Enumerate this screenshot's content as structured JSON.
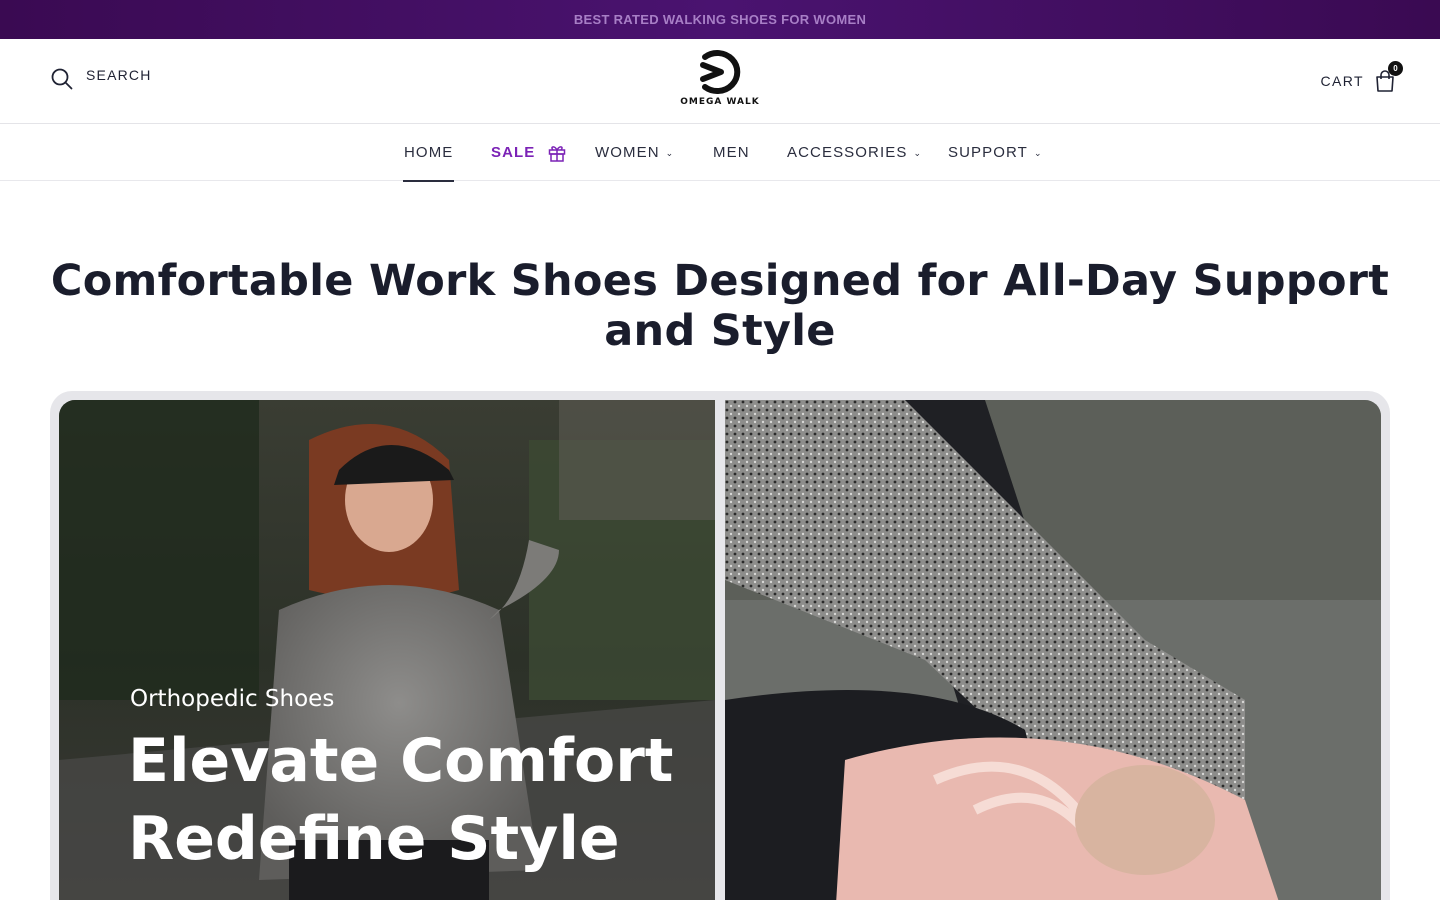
{
  "announcement": {
    "text": "BEST RATED WALKING SHOES FOR WOMEN"
  },
  "header": {
    "search_label": "SEARCH",
    "search_icon": "search-icon",
    "logo_text": "OMEGA WALK",
    "cart_label": "CART",
    "cart_count": "0",
    "cart_icon": "shopping-bag-icon"
  },
  "nav": {
    "items": [
      {
        "label": "HOME",
        "active": true
      },
      {
        "label": "SALE",
        "icon": "gift-icon"
      },
      {
        "label": "WOMEN",
        "dropdown": true
      },
      {
        "label": "MEN"
      },
      {
        "label": "ACCESSORIES",
        "dropdown": true
      },
      {
        "label": "SUPPORT",
        "dropdown": true
      }
    ],
    "caret": "⌄"
  },
  "page": {
    "title": "Comfortable Work Shoes Designed for All-Day Support and Style"
  },
  "hero": {
    "kicker": "Orthopedic Shoes",
    "headline_line1": "Elevate Comfort",
    "headline_line2": "Redefine Style"
  },
  "colors": {
    "announcement_bg": "#3a0a52",
    "announcement_text": "#a87fc6",
    "sale_accent": "#7b22b6",
    "text_dark": "#1f2233"
  }
}
